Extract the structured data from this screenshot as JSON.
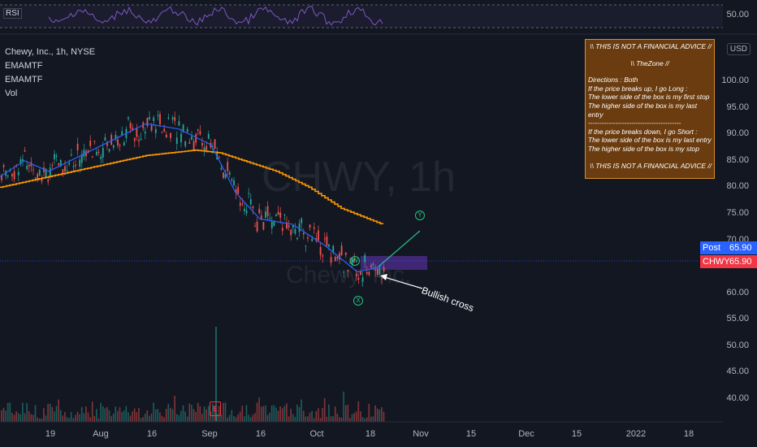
{
  "legend": {
    "symbol": "Chewy, Inc., 1h, NYSE",
    "ind1": "EMAMTF",
    "ind2": "EMAMTF",
    "ind3": "Vol"
  },
  "rsi": {
    "label": "RSI",
    "level": "50.00"
  },
  "currency": "USD",
  "y_ticks": [
    "100.00",
    "95.00",
    "90.00",
    "85.00",
    "80.00",
    "75.00",
    "70.00",
    "60.00",
    "55.00",
    "50.00",
    "45.00",
    "40.00"
  ],
  "x_ticks": [
    "19",
    "Aug",
    "16",
    "Sep",
    "16",
    "Oct",
    "18",
    "Nov",
    "15",
    "Dec",
    "15",
    "2022",
    "18"
  ],
  "price_tags": {
    "post": {
      "name": "Post",
      "value": "65.90",
      "color": "#2962ff"
    },
    "last": {
      "name": "CHWY",
      "value": "65.90",
      "color": "#f23645"
    }
  },
  "note": {
    "line1": "\\\\ THIS IS NOT A FINANCIAL ADVICE //",
    "line2": "\\\\ TheZone //",
    "line3": "Directions : Both",
    "line4": "If the price breaks up, I  go Long :",
    "line5": "The lower side of the box  is my first stop",
    "line6": "The higher side of the box is my last entry",
    "line7": "-----------------------------------------",
    "line8": "If the price breaks down, I  go Short :",
    "line9": "The lower side of the box is my last entry",
    "line10": "The higher side of the box is my stop",
    "line11": "\\\\ THIS IS NOT A FINANCIAL ADVICE //"
  },
  "watermark": {
    "big": "CHWY, 1h",
    "small": "Chewy, Inc."
  },
  "annotations": {
    "bullish": "Bullish cross",
    "w": "W",
    "x": "X",
    "y": "Y",
    "earnings": "E"
  },
  "chart_data": {
    "type": "candlestick",
    "price_ylim": [
      37,
      103
    ],
    "last_price": 65.9,
    "ema_fast": [
      [
        0,
        82
      ],
      [
        30,
        85
      ],
      [
        60,
        83
      ],
      [
        100,
        86
      ],
      [
        140,
        89
      ],
      [
        180,
        92
      ],
      [
        220,
        91
      ],
      [
        260,
        88
      ],
      [
        290,
        79
      ],
      [
        320,
        74
      ],
      [
        360,
        73
      ],
      [
        400,
        69
      ],
      [
        440,
        64
      ],
      [
        470,
        65
      ]
    ],
    "ema_slow": [
      [
        0,
        80
      ],
      [
        60,
        82
      ],
      [
        120,
        84
      ],
      [
        180,
        86
      ],
      [
        240,
        87
      ],
      [
        270,
        86.5
      ],
      [
        300,
        85
      ],
      [
        340,
        83
      ],
      [
        380,
        80
      ],
      [
        420,
        76
      ],
      [
        470,
        73
      ]
    ],
    "box": {
      "from": 440,
      "to": 525,
      "low": 65,
      "high": 67.5
    }
  }
}
